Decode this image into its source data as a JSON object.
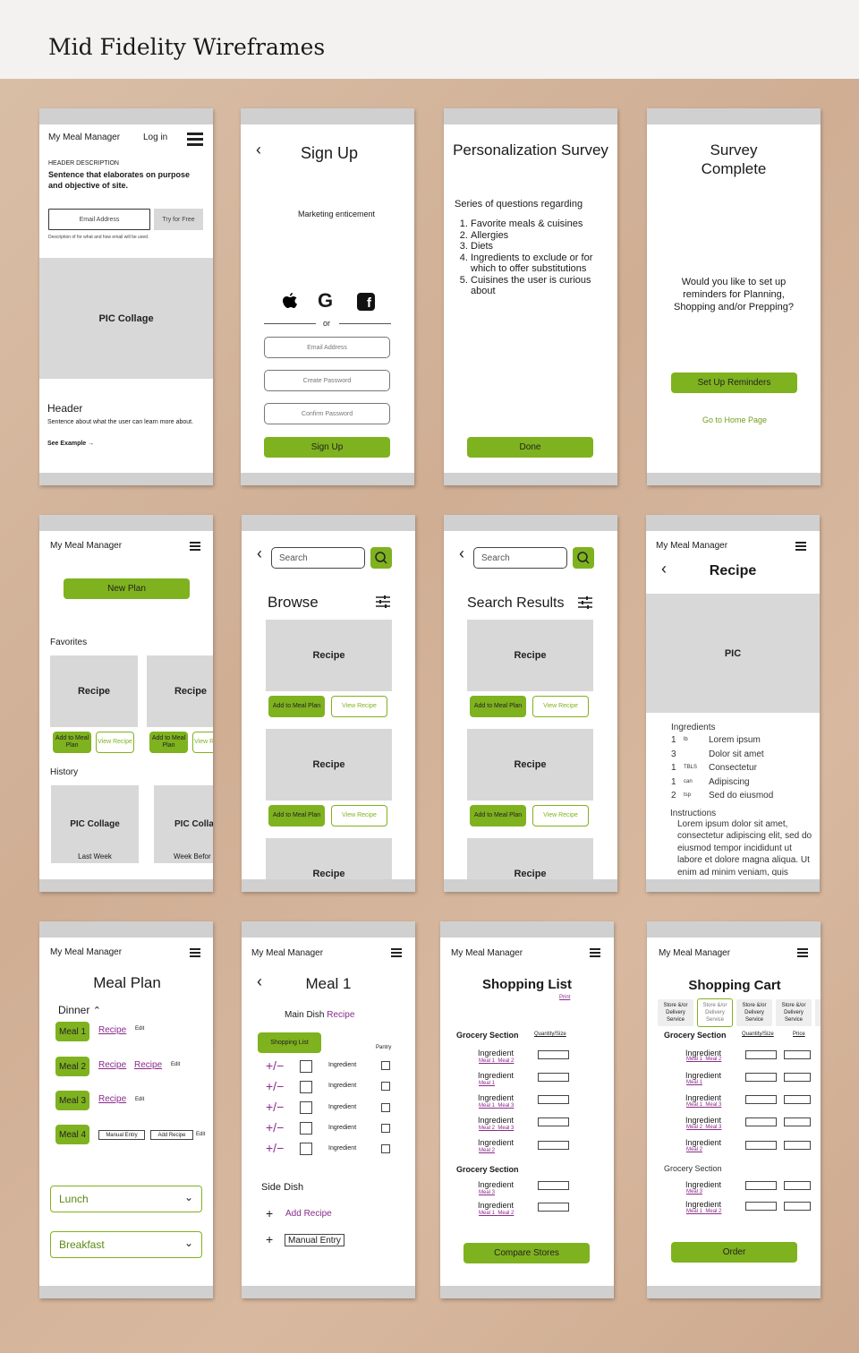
{
  "page": {
    "title": "Mid Fidelity Wireframes"
  },
  "s1": {
    "app_name": "My Meal Manager",
    "login": "Log in",
    "header_desc": "HEADER  DESCRIPTION",
    "sentence": "Sentence that elaborates on purpose and objective of site.",
    "email": "Email Address",
    "try": "Try for Free",
    "desc": "Description of for what and how email will be used.",
    "pic": "PIC Collage",
    "header": "Header",
    "about": "Sentence about what the user can learn more about.",
    "see": "See Example"
  },
  "s2": {
    "title": "Sign Up",
    "marketing": "Marketing enticement",
    "or": "or",
    "email": "Email Address",
    "create": "Create Password",
    "confirm": "Confirm Password",
    "signup": "Sign Up"
  },
  "s3": {
    "title": "Personalization Survey",
    "intro": "Series of questions regarding",
    "items": [
      "Favorite meals & cuisines",
      "Allergies",
      "Diets",
      "Ingredients to exclude or for which to offer substitutions",
      "Cuisines the user is curious about"
    ],
    "done": "Done"
  },
  "s4": {
    "title": "Survey Complete",
    "question": "Would you like to set up reminders for Planning, Shopping and/or Prepping?",
    "setup": "Set Up Reminders",
    "home": "Go to Home Page"
  },
  "s5": {
    "app_name": "My Meal Manager",
    "new_plan": "New Plan",
    "favorites": "Favorites",
    "recipe": "Recipe",
    "add": "Add to Meal Plan",
    "view": "View Recipe",
    "history": "History",
    "pic": "PIC Collage",
    "pic_partial": "PIC Colla",
    "last_week": "Last Week",
    "week_before": "Week Befor"
  },
  "s6": {
    "search": "Search",
    "title": "Browse",
    "recipe": "Recipe",
    "add": "Add to Meal Plan",
    "view": "View Recipe"
  },
  "s7": {
    "search": "Search",
    "title": "Search Results",
    "recipe": "Recipe",
    "add": "Add to Meal Plan",
    "view": "View Recipe"
  },
  "s8": {
    "app_name": "My Meal Manager",
    "title": "Recipe",
    "pic": "PIC",
    "ingredients_label": "Ingredients",
    "ingredients": [
      {
        "qty": "1",
        "unit": "lb",
        "name": "Lorem ipsum"
      },
      {
        "qty": "3",
        "unit": "",
        "name": "Dolor sit amet"
      },
      {
        "qty": "1",
        "unit": "TBLS",
        "name": "Consectetur"
      },
      {
        "qty": "1",
        "unit": "can",
        "name": "Adipiscing"
      },
      {
        "qty": "2",
        "unit": "tsp",
        "name": "Sed do eiusmod"
      }
    ],
    "instructions_label": "Instructions",
    "instructions": "Lorem ipsum dolor sit amet, consectetur adipiscing elit, sed do eiusmod tempor incididunt ut labore et dolore magna aliqua. Ut enim ad minim veniam, quis"
  },
  "s9": {
    "app_name": "My Meal Manager",
    "title": "Meal Plan",
    "dinner": "Dinner",
    "meal1": "Meal 1",
    "meal2": "Meal 2",
    "meal3": "Meal 3",
    "meal4": "Meal 4",
    "recipe": "Recipe",
    "edit": "Edit",
    "manual": "Manual Entry",
    "add_recipe": "Add Recipe",
    "lunch": "Lunch",
    "breakfast": "Breakfast"
  },
  "s10": {
    "app_name": "My Meal Manager",
    "title": "Meal 1",
    "main_dish": "Main Dish",
    "recipe": "Recipe",
    "shopping": "Shopping List",
    "pantry": "Pantry",
    "ingredient": "Ingredient",
    "pm": "+/−",
    "side": "Side Dish",
    "add_recipe": "Add Recipe",
    "manual": "Manual Entry"
  },
  "s11": {
    "app_name": "My Meal Manager",
    "title": "Shopping List",
    "print": "Print",
    "section": "Grocery Section",
    "qty": "Quantity/Size",
    "ingredient": "Ingredient",
    "compare": "Compare Stores"
  },
  "s12": {
    "app_name": "My Meal Manager",
    "title": "Shopping Cart",
    "store": "Store &/or Delivery Service",
    "section": "Grocery Section",
    "qty": "Quantity/Size",
    "price": "Price",
    "ingredient": "Ingredient",
    "order": "Order"
  },
  "meals": {
    "m1": "Meal 1",
    "m2": "Meal 2",
    "m3": "Meal 3"
  },
  "colors": {
    "accent": "#7fb21f",
    "link": "#8b2a8b",
    "placeholder": "#d8d8d8"
  }
}
